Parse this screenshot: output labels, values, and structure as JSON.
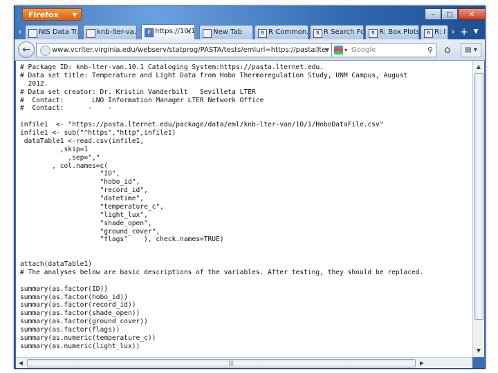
{
  "browser": {
    "menu_button": "Firefox",
    "window_controls": {
      "minimize": "–",
      "maximize": "□",
      "close": "✕"
    }
  },
  "tabs": [
    {
      "label": "NIS Data Tr...",
      "active": false
    },
    {
      "label": "knb-lter-va...",
      "active": false
    },
    {
      "label": "https://10/1",
      "active": true
    },
    {
      "label": "New Tab",
      "active": false
    },
    {
      "label": "R Common...",
      "active": false
    },
    {
      "label": "R Search Fo...",
      "active": false
    },
    {
      "label": "R: Box Plots",
      "active": false
    },
    {
      "label": "R: I",
      "active": false
    }
  ],
  "navbar": {
    "url": "www.vcrlter.virginia.edu/webserv/statprog/PASTA/tests/emlurl=https://pasta.lte",
    "search_placeholder": "Google"
  },
  "code_lines": [
    "# Package ID: knb-lter-van.10.1 Cataloging System:https://pasta.lternet.edu.",
    "# Data set title: Temperature and Light Data from Hobo Thermoregulation Study, UNM Campus, August",
    "  2012.",
    "# Data set creator: Dr. Kristin Vanderbilt   Sevilleta LTER",
    "#  Contact:       LNO Information Manager LTER Network Office",
    "#  Contact:      -    -",
    "",
    "infile1  <- \"https://pasta.lternet.edu/package/data/eml/knb-lter-van/10/1/HoboDataFile.csv\"",
    "infile1 <- sub(\"^https\",\"http\",infile1)",
    " dataTable1 <-read.csv(infile1,",
    "          ,skip=1",
    "            ,sep=\",\"",
    "        , col.names=c(",
    "                    \"ID\",",
    "                    \"hobo_id\",",
    "                    \"record_id\",",
    "                    \"datetime\",",
    "                    \"temperature_c\",",
    "                    \"light_lux\",",
    "                    \"shade_open\",",
    "                    \"ground_cover\",",
    "                    \"flags\"    ), check.names=TRUE)",
    "",
    "",
    "attach(dataTable1)",
    "# The analyses below are basic descriptions of the variables. After testing, they should be replaced.",
    "",
    "summary(as.factor(ID))",
    "summary(as.factor(hobo_id))",
    "summary(as.factor(record_id))",
    "summary(as.factor(shade_open))",
    "summary(as.factor(ground_cover))",
    "summary(as.factor(flags))",
    "summary(as.numeric(temperature_c))",
    "summary(as.numeric(light_lux))"
  ]
}
